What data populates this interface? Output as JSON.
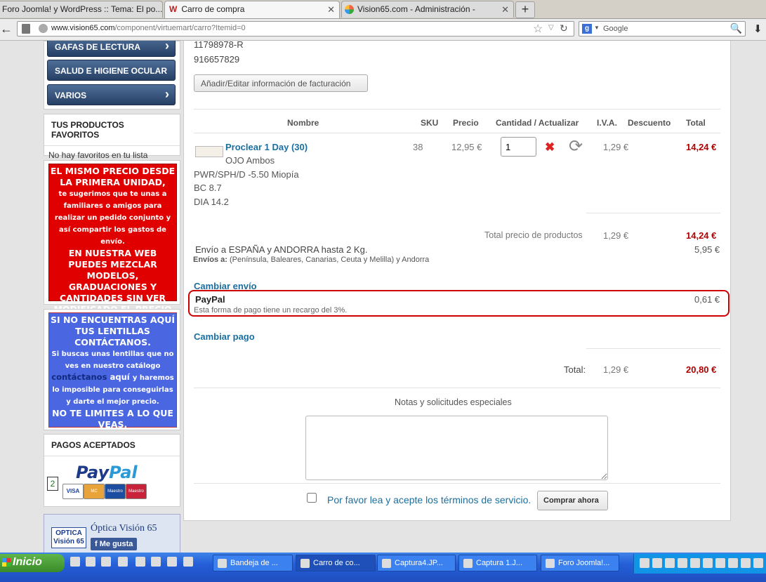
{
  "browser": {
    "tabs": [
      {
        "label": "Foro Joomla! y WordPress :: Tema: El po...",
        "favicon": ""
      },
      {
        "label": "Carro de compra",
        "favicon": "W"
      },
      {
        "label": "Vision65.com - Administración -",
        "favicon": ""
      }
    ],
    "new_tab": "+",
    "url_domain": "www.vision65.com",
    "url_path": "/component/virtuemart/carro?Itemid=0",
    "search_placeholder": "Google"
  },
  "sidebar": {
    "menu": [
      {
        "label": "GAFAS DE LECTURA"
      },
      {
        "label": "SALUD E HIGIENE OCULAR"
      },
      {
        "label": "VARIOS"
      }
    ],
    "favorites": {
      "title": "TUS PRODUCTOS FAVORITOS",
      "text": "No hay favoritos en tu lista"
    },
    "promo_red": {
      "l1": "EL MISMO PRECIO DESDE LA PRIMERA UNIDAD,",
      "l2": "te sugerimos que te unas a familiares o amigos para realizar un pedido conjunto y así compartir los gastos de envío.",
      "l3": "EN NUESTRA WEB PUEDES MEZCLAR MODELOS, GRADUACIONES Y CANTIDADES SIN VER MODIFICADO EL PRECIO POR CAJA."
    },
    "promo_blue": {
      "l1": "SI NO ENCUENTRAS AQUÍ TUS LENTILLAS CONTÁCTANOS.",
      "l2a": "Si buscas unas lentillas que no ves en nuestro catálogo",
      "l2b": "contáctanos",
      "l2c": "aquí",
      "l2d": "y haremos lo imposible para  conseguirlas y darte el mejor precio.",
      "l3": "NO TE LIMITES A LO QUE VEAS."
    },
    "payments": {
      "title": "PAGOS ACEPTADOS",
      "paypal_a": "Pay",
      "paypal_b": "Pal",
      "badge_number": "2",
      "cards": [
        "VISA",
        "MC",
        "Maestro",
        "Maestro"
      ]
    },
    "optica": {
      "logo": "OPTICA Visión 65",
      "name": "Óptica Visión 65",
      "like": "Me gusta"
    }
  },
  "cart": {
    "billing_id": "11798978-R",
    "billing_phone": "916657829",
    "billing_button": "Añadir/Editar información de facturación",
    "headers": {
      "name": "Nombre",
      "sku": "SKU",
      "price": "Precio",
      "qty": "Cantidad / Actualizar",
      "vat": "I.V.A.",
      "discount": "Descuento",
      "total": "Total"
    },
    "item": {
      "name": "Proclear 1 Day (30)",
      "eye": "OJO Ambos",
      "power": "PWR/SPH/D -5.50 Miopía",
      "bc": "BC 8.7",
      "dia": "DIA 14.2",
      "sku": "38",
      "price": "12,95 €",
      "qty": "1",
      "vat": "1,29 €",
      "total": "14,24 €"
    },
    "product_total_label": "Total precio de productos",
    "product_total_vat": "1,29 €",
    "product_total": "14,24 €",
    "shipping_label": "Envío a ESPAÑA y ANDORRA hasta 2 Kg.",
    "shipping_detail_bold": "Envíos a:",
    "shipping_detail": "(Península, Baleares, Canarias, Ceuta y Melilla) y Andorra",
    "shipping_price": "5,95 €",
    "change_shipping": "Cambiar envío",
    "payment_name": "PayPal",
    "payment_desc": "Esta forma de pago tiene un recargo del 3%.",
    "payment_fee": "0,61 €",
    "change_payment": "Cambiar pago",
    "grand_total_label": "Total:",
    "grand_total_vat": "1,29 €",
    "grand_total": "20,80 €",
    "notes_label": "Notas y solicitudes especiales",
    "tos_label": "Por favor lea y acepte los términos de servicio.",
    "buy_button": "Comprar ahora",
    "colors": {
      "accent_red": "#b00000",
      "link": "#1a6fa0",
      "highlight_border": "#cc0000"
    }
  },
  "taskbar": {
    "start": "Inicio",
    "tasks": [
      "Bandeja de ...",
      "Carro de co...",
      "Captura4.JP...",
      "Captura 1.J...",
      "Foro Joomla!..."
    ]
  }
}
